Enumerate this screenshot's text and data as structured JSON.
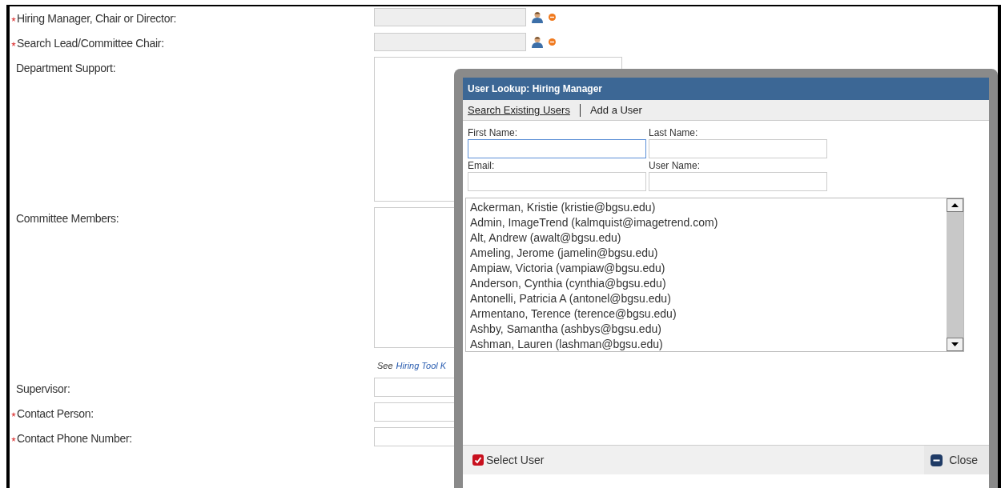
{
  "form": {
    "rows": [
      {
        "kind": "lookup",
        "label": "Hiring Manager, Chair or Director:",
        "required": true
      },
      {
        "kind": "lookup",
        "label": "Search Lead/Committee Chair:",
        "required": true
      },
      {
        "kind": "textarea",
        "label": "Department Support:",
        "required": false
      },
      {
        "kind": "textarea",
        "label": "Committee Members:",
        "required": false
      },
      {
        "kind": "note",
        "prefix": "See",
        "link": "Hiring Tool K"
      },
      {
        "kind": "text",
        "label": "Supervisor:",
        "required": false
      },
      {
        "kind": "text",
        "label": "Contact Person:",
        "required": true
      },
      {
        "kind": "text",
        "label": "Contact Phone Number:",
        "required": true
      }
    ]
  },
  "dialog": {
    "title": "User Lookup: Hiring Manager",
    "tabs": [
      {
        "label": "Search Existing Users",
        "selected": true
      },
      {
        "label": "Add a User",
        "selected": false
      }
    ],
    "fields": [
      {
        "label": "First Name:",
        "focused": true
      },
      {
        "label": "Last Name:",
        "focused": false
      },
      {
        "label": "Email:",
        "focused": false
      },
      {
        "label": "User Name:",
        "focused": false
      }
    ],
    "users": [
      "Ackerman, Kristie (kristie@bgsu.edu)",
      "Admin, ImageTrend (kalmquist@imagetrend.com)",
      "Alt, Andrew (awalt@bgsu.edu)",
      "Ameling, Jerome (jamelin@bgsu.edu)",
      "Ampiaw, Victoria (vampiaw@bgsu.edu)",
      "Anderson, Cynthia (cynthia@bgsu.edu)",
      "Antonelli, Patricia A (antonel@bgsu.edu)",
      "Armentano, Terence (terence@bgsu.edu)",
      "Ashby, Samantha (ashbys@bgsu.edu)",
      "Ashman, Lauren (lashman@bgsu.edu)"
    ],
    "buttons": [
      {
        "kind": "select",
        "label": "Select User"
      },
      {
        "kind": "close",
        "label": "Close"
      }
    ]
  }
}
